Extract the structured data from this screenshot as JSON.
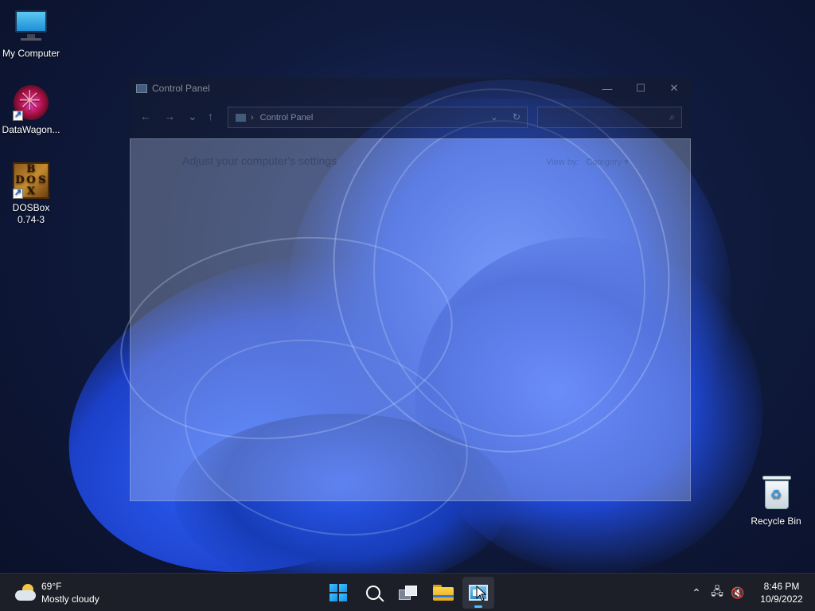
{
  "desktop": {
    "icons": [
      {
        "label": "My Computer",
        "icon": "computer-icon"
      },
      {
        "label": "DataWagon...",
        "icon": "datawagon-icon"
      },
      {
        "label_line1": "DOSBox",
        "label_line2": "0.74-3",
        "icon": "dosbox-icon",
        "logo_letters": [
          "B",
          "D",
          "O",
          "S",
          "X"
        ]
      },
      {
        "label": "Recycle Bin",
        "icon": "recycle-bin-icon"
      }
    ]
  },
  "window": {
    "title": "Control Panel",
    "minimize_glyph": "—",
    "maximize_glyph": "☐",
    "close_glyph": "✕",
    "address": "Control Panel",
    "address_chevron": "›",
    "heading": "Adjust your computer's settings",
    "view_by_label": "View by:",
    "view_by_value": "Category",
    "view_by_arrow": "▾",
    "nav": {
      "back": "←",
      "forward": "→",
      "recent": "⌄",
      "up": "↑"
    },
    "addr_tools": {
      "dropdown": "⌄",
      "refresh": "↻"
    },
    "search_icon": "⌕"
  },
  "taskbar": {
    "weather": {
      "temp": "69°F",
      "condition": "Mostly cloudy"
    },
    "tray": {
      "chevron": "⌃",
      "network": "🖧",
      "volume": "🔇"
    },
    "clock": {
      "time": "8:46 PM",
      "date": "10/9/2022"
    }
  }
}
